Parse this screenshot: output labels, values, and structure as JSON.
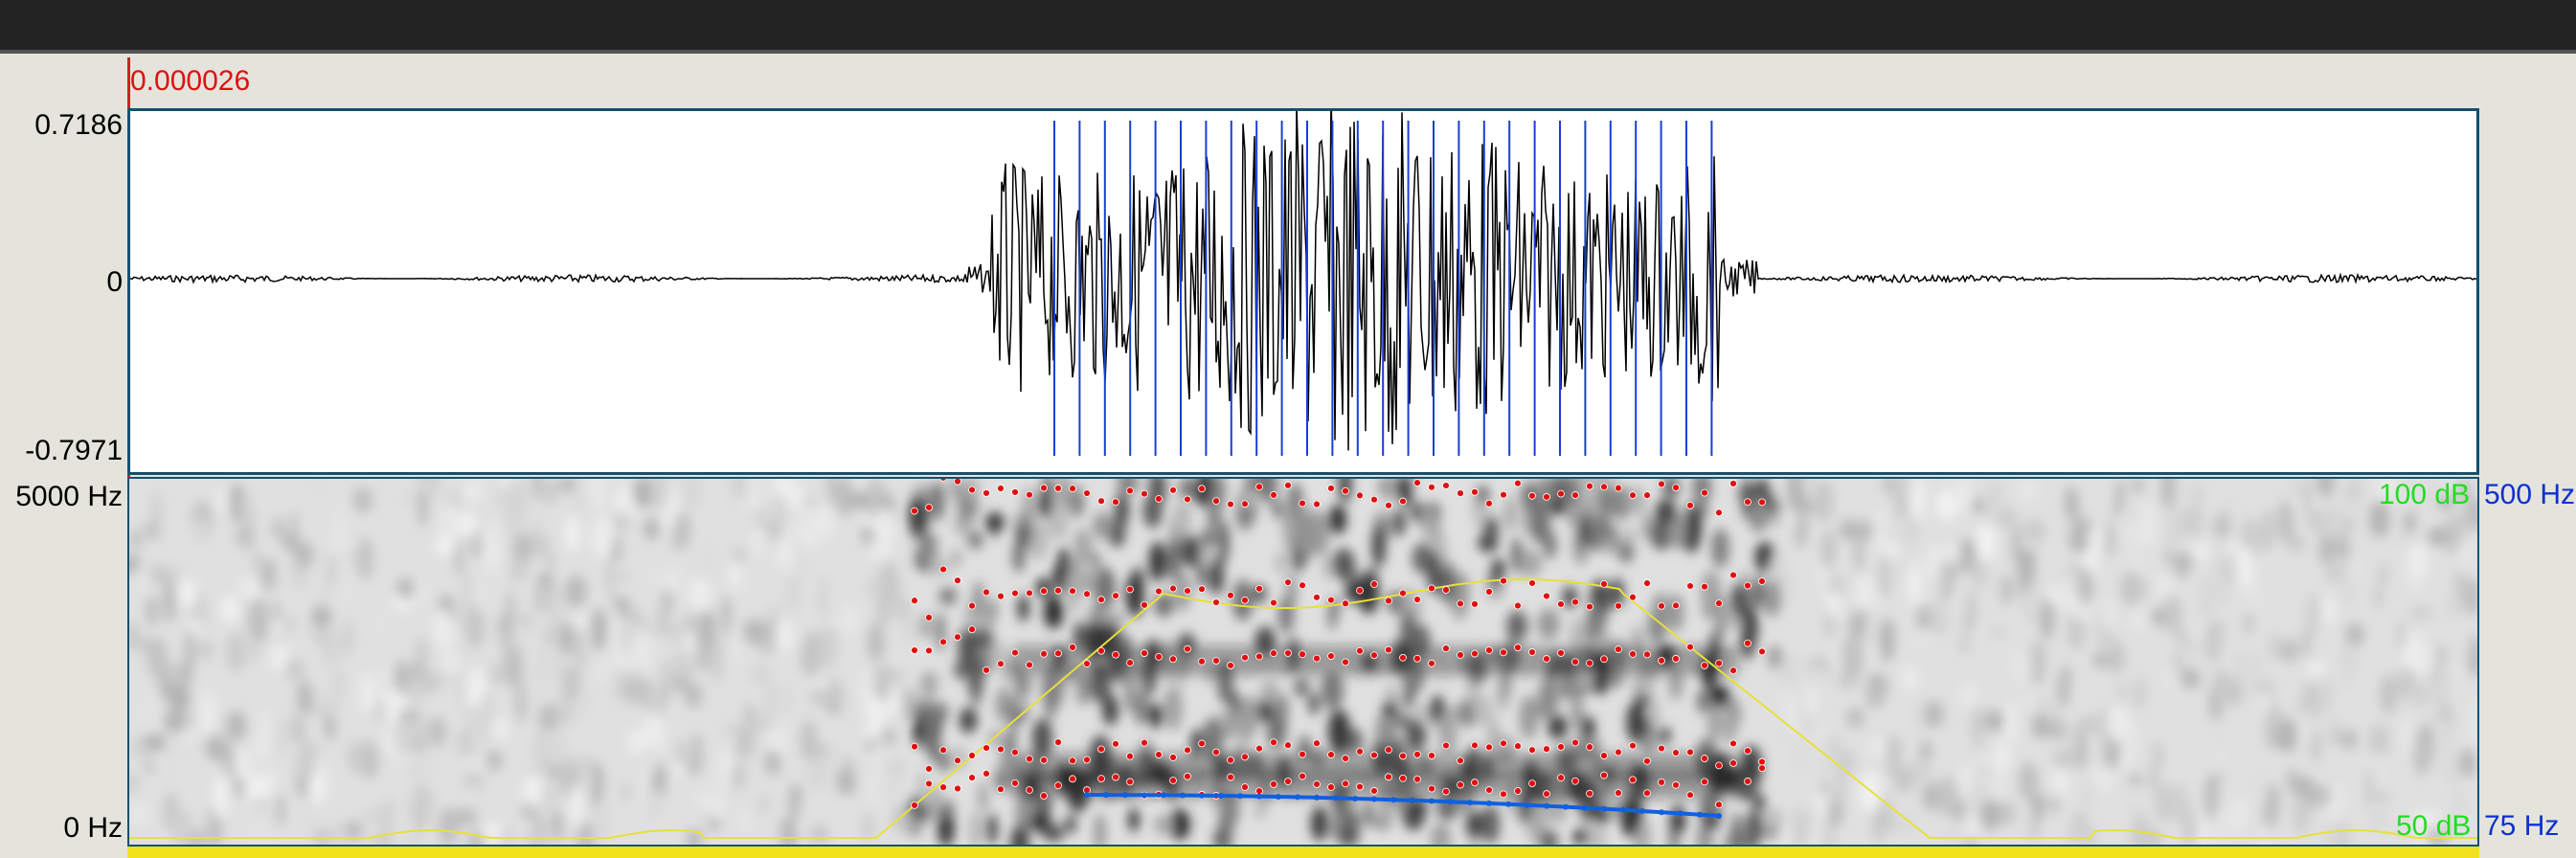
{
  "window": {
    "title": ""
  },
  "cursor": {
    "time": "0.000026"
  },
  "waveform": {
    "ymax_label": "0.7186",
    "zero_label": "0",
    "ymin_label": "-0.7971"
  },
  "spectrogram": {
    "freq_max_label": "5000 Hz",
    "freq_min_label": "0 Hz",
    "intensity_max_label": "100 dB",
    "intensity_min_label": "50 dB",
    "pitch_max_label": "500 Hz",
    "pitch_min_label": "75 Hz"
  },
  "colors": {
    "cursor": "#e01010",
    "pulses": "#1a3fd0",
    "formants": "#e01010",
    "intensity": "#e8e03a",
    "pitch": "#1060e0",
    "intensity_labels": "#22dd22",
    "pitch_labels": "#1030d0"
  }
}
